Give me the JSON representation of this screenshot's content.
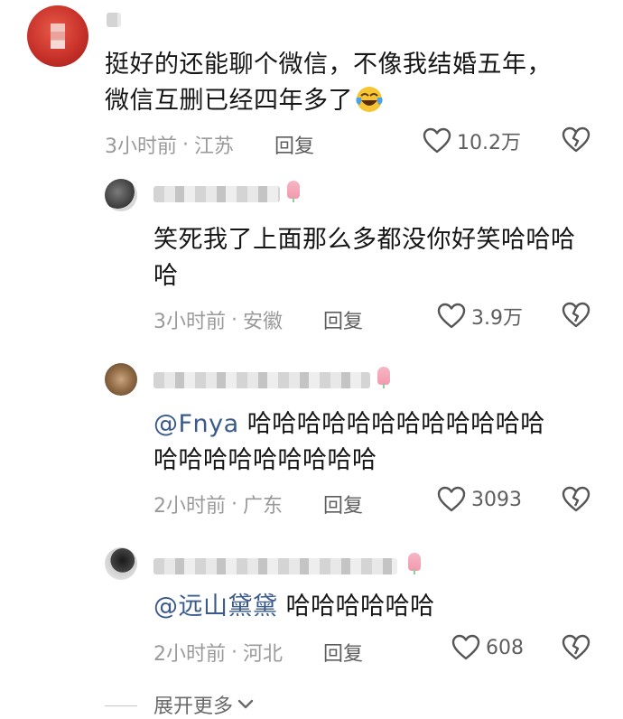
{
  "comments": [
    {
      "text_line1": "挺好的还能聊个微信，不像我结婚五年，",
      "text_line2": "微信互删已经四年多了",
      "emoji": "laughing-crying-emoji",
      "time": "3小时前",
      "location": "江苏",
      "reply_label": "回复",
      "like_count": "10.2万"
    }
  ],
  "replies": [
    {
      "text_line1": "笑死我了上面那么多都没你好笑哈哈哈",
      "text_line2": "哈",
      "time": "3小时前",
      "location": "安徽",
      "reply_label": "回复",
      "like_count": "3.9万"
    },
    {
      "mention": "@Fnya",
      "text_line1": " 哈哈哈哈哈哈哈哈哈哈哈哈",
      "text_line2": "哈哈哈哈哈哈哈哈哈",
      "time": "2小时前",
      "location": "广东",
      "reply_label": "回复",
      "like_count": "3093"
    },
    {
      "mention": "@远山黛黛",
      "text_line1": " 哈哈哈哈哈哈",
      "time": "2小时前",
      "location": "河北",
      "reply_label": "回复",
      "like_count": "608"
    }
  ],
  "expand": {
    "label": "展开更多"
  },
  "meta_separator": "·"
}
